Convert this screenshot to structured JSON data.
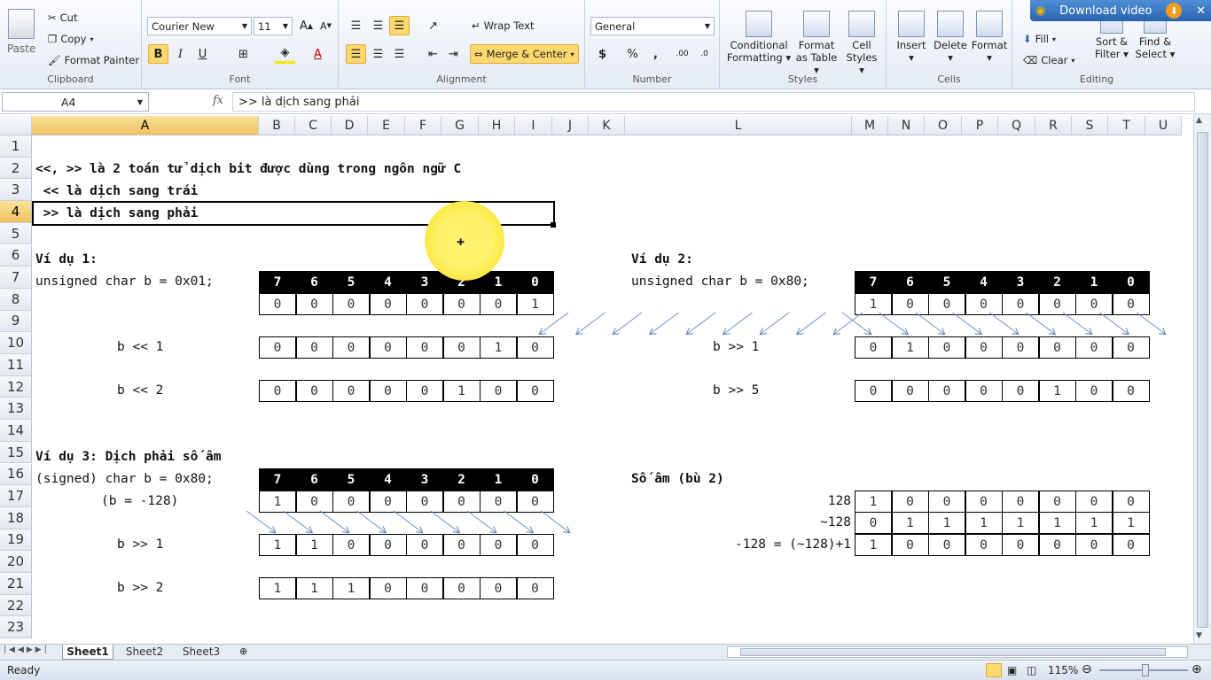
{
  "clipboard": {
    "paste": "Paste",
    "cut": "Cut",
    "copy": "Copy",
    "format_painter": "Format Painter",
    "label": "Clipboard"
  },
  "font": {
    "name": "Courier New",
    "size": "11",
    "bold": "B",
    "italic": "I",
    "underline": "U",
    "label": "Font"
  },
  "alignment": {
    "wrap_text": "Wrap Text",
    "merge_center": "Merge & Center",
    "label": "Alignment"
  },
  "number": {
    "format": "General",
    "currency": "$",
    "percent": "%",
    "comma": ",",
    "increase_decimal": ".00",
    "decrease_decimal": ".0",
    "label": "Number"
  },
  "styles": {
    "conditional": "Conditional Formatting",
    "format_table": "Format as Table",
    "cell_styles": "Cell Styles",
    "label": "Styles"
  },
  "cells": {
    "insert": "Insert",
    "delete": "Delete",
    "format": "Format",
    "label": "Cells"
  },
  "editing": {
    "fill": "Fill",
    "clear": "Clear",
    "sort_filter": "Sort & Filter",
    "find_select": "Find & Select",
    "label": "Editing"
  },
  "download": "Download video",
  "formula_bar": {
    "name_box": "A4",
    "fx": "fx",
    "formula": ">> là dịch sang phải"
  },
  "columns": [
    "A",
    "B",
    "C",
    "D",
    "E",
    "F",
    "G",
    "H",
    "I",
    "J",
    "K",
    "L",
    "M",
    "N",
    "O",
    "P",
    "Q",
    "R",
    "S",
    "T",
    "U"
  ],
  "rows": [
    "1",
    "2",
    "3",
    "4",
    "5",
    "6",
    "7",
    "8",
    "9",
    "10",
    "11",
    "12",
    "13",
    "14",
    "15",
    "16",
    "17",
    "18",
    "19",
    "20",
    "21",
    "22",
    "23"
  ],
  "content": {
    "r2": "<<, >> là 2 toán tử dịch bit được dùng trong ngôn ngữ C",
    "r3": " << là dịch sang trái",
    "r4": " >> là dịch sang phải",
    "ex1_title": "Ví dụ 1:",
    "ex1_decl": "unsigned char b = 0x01;",
    "ex1_shift1": "b << 1",
    "ex1_shift2": "b << 2",
    "ex2_title": "Ví dụ 2:",
    "ex2_decl": "unsigned char b = 0x80;",
    "ex2_shift1": "b >> 1",
    "ex2_shift2": "b >> 5",
    "ex3_title": "Ví dụ 3: Dịch phải số âm",
    "ex3_decl": "(signed) char b = 0x80;",
    "ex3_value": "(b = -128)",
    "ex3_shift1": "b >> 1",
    "ex3_shift2": "b >> 2",
    "neg_title": "Số âm (bù 2)",
    "neg_128": "128",
    "neg_not": "~128",
    "neg_formula": "-128 = (~128)+1"
  },
  "bit_header": [
    "7",
    "6",
    "5",
    "4",
    "3",
    "2",
    "1",
    "0"
  ],
  "grids": {
    "ex1_b": [
      "0",
      "0",
      "0",
      "0",
      "0",
      "0",
      "0",
      "1"
    ],
    "ex1_s1": [
      "0",
      "0",
      "0",
      "0",
      "0",
      "0",
      "1",
      "0"
    ],
    "ex1_s2": [
      "0",
      "0",
      "0",
      "0",
      "0",
      "1",
      "0",
      "0"
    ],
    "ex2_b": [
      "1",
      "0",
      "0",
      "0",
      "0",
      "0",
      "0",
      "0"
    ],
    "ex2_s1": [
      "0",
      "1",
      "0",
      "0",
      "0",
      "0",
      "0",
      "0"
    ],
    "ex2_s5": [
      "0",
      "0",
      "0",
      "0",
      "0",
      "1",
      "0",
      "0"
    ],
    "ex3_b": [
      "1",
      "0",
      "0",
      "0",
      "0",
      "0",
      "0",
      "0"
    ],
    "ex3_s1": [
      "1",
      "1",
      "0",
      "0",
      "0",
      "0",
      "0",
      "0"
    ],
    "ex3_s2": [
      "1",
      "1",
      "1",
      "0",
      "0",
      "0",
      "0",
      "0"
    ],
    "neg_128": [
      "1",
      "0",
      "0",
      "0",
      "0",
      "0",
      "0",
      "0"
    ],
    "neg_not": [
      "0",
      "1",
      "1",
      "1",
      "1",
      "1",
      "1",
      "1"
    ],
    "neg_res": [
      "1",
      "0",
      "0",
      "0",
      "0",
      "0",
      "0",
      "0"
    ]
  },
  "sheets": [
    "Sheet1",
    "Sheet2",
    "Sheet3"
  ],
  "status": {
    "ready": "Ready",
    "zoom": "115%"
  }
}
